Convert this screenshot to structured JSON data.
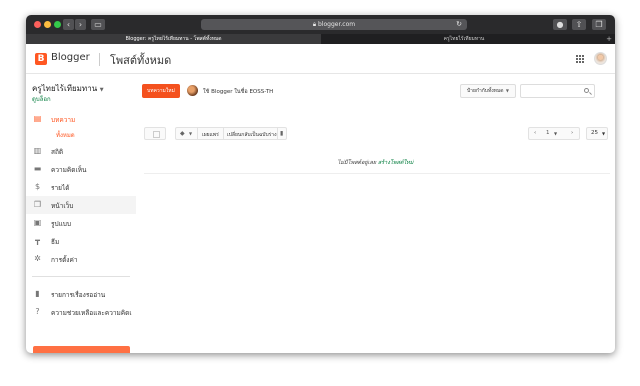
{
  "browser": {
    "url": "blogger.com",
    "tabs": [
      {
        "label": "Blogger: ครูไทยไร้เทียมทาน - โพสต์ทั้งหมด",
        "active": true
      },
      {
        "label": "ครูไทยไร้เทียมทาน",
        "active": false
      }
    ]
  },
  "appbar": {
    "brand": "Blogger",
    "page_title": "โพสต์ทั้งหมด"
  },
  "sidebar": {
    "blog_name": "ครูไทยไร้เทียมทาน",
    "view_blog": "ดูบล็อก",
    "items": [
      {
        "label": "บทความ",
        "icon": "posts-icon",
        "active": true
      },
      {
        "label": "สถิติ",
        "icon": "stats-icon"
      },
      {
        "label": "ความคิดเห็น",
        "icon": "comments-icon"
      },
      {
        "label": "รายได้",
        "icon": "earnings-icon"
      },
      {
        "label": "หน้าเว็บ",
        "icon": "pages-icon"
      },
      {
        "label": "รูปแบบ",
        "icon": "layout-icon"
      },
      {
        "label": "ธีม",
        "icon": "theme-icon"
      },
      {
        "label": "การตั้งค่า",
        "icon": "settings-icon"
      },
      {
        "label": "รายการเรื่องรออ่าน",
        "icon": "reading-list-icon"
      },
      {
        "label": "ความช่วยเหลือและความคิดเ",
        "icon": "help-icon"
      }
    ],
    "sub_item": "ทั้งหมด"
  },
  "main": {
    "new_post_label": "บทความใหม่",
    "using_as": "ใช้ Blogger ในชื่อ EOSS-TH",
    "filter_label": "ป้ายกำกับทั้งหมด",
    "toolbar": {
      "publish": "เผยแพร่",
      "revert": "เปลี่ยนกลับเป็นฉบับร่าง"
    },
    "pager_value": "1",
    "per_page": "25",
    "empty_text": "ไม่มีโพสต์อยู่เลย",
    "create_post_link": "สร้างโพสต์ใหม่"
  },
  "colors": {
    "accent": "#ff5722",
    "link": "#0b8043"
  }
}
